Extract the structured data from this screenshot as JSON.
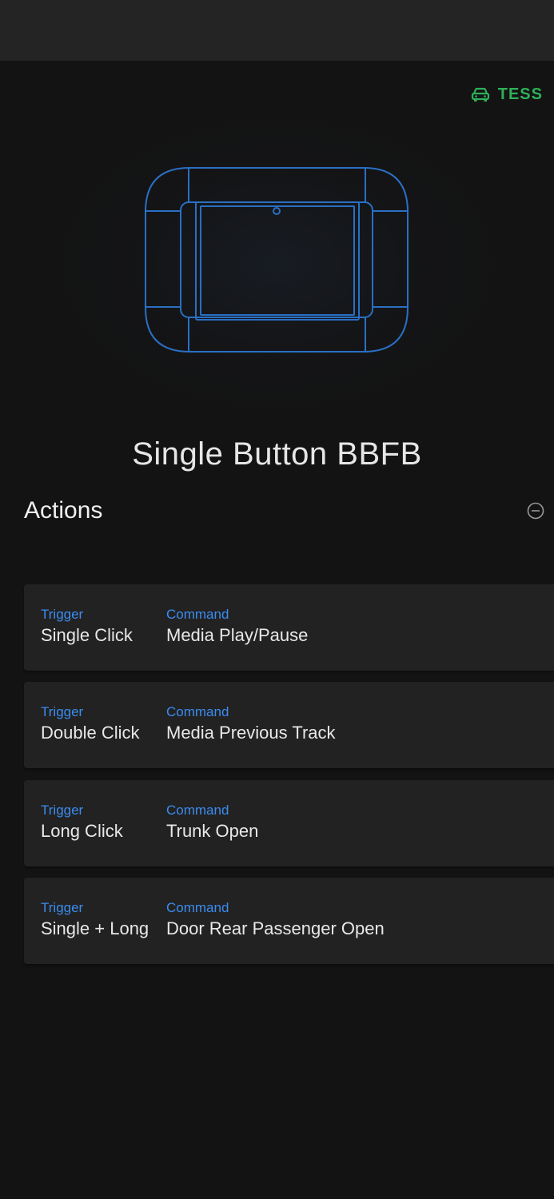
{
  "vehicle": {
    "name": "TESS",
    "icon": "car-icon",
    "color": "#2fb05a"
  },
  "device": {
    "name": "Single Button BBFB",
    "illustration_icon": "button-device-icon",
    "outline_color": "#2a6fc4"
  },
  "actions": {
    "header": "Actions",
    "collapse_icon": "minus-circle-icon",
    "trigger_label_color": "#3b8cf0",
    "items": [
      {
        "trigger_label": "Trigger",
        "trigger": "Single Click",
        "command_label": "Command",
        "command": "Media Play/Pause"
      },
      {
        "trigger_label": "Trigger",
        "trigger": "Double Click",
        "command_label": "Command",
        "command": "Media Previous Track"
      },
      {
        "trigger_label": "Trigger",
        "trigger": "Long Click",
        "command_label": "Command",
        "command": "Trunk Open"
      },
      {
        "trigger_label": "Trigger",
        "trigger": "Single + Long",
        "command_label": "Command",
        "command": "Door Rear Passenger Open"
      }
    ]
  }
}
